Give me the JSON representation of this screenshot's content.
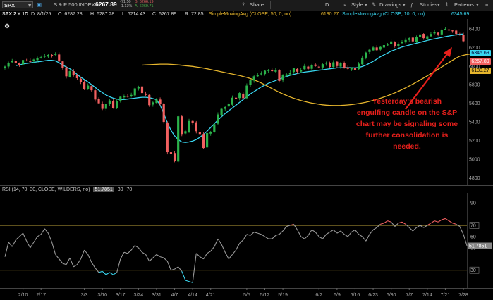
{
  "toolbar": {
    "symbol": "SPX",
    "description": "S & P 500 INDEX",
    "last_price": "6267.89",
    "change": "-71.50",
    "change_pct": "-1.13%",
    "bid": "6266.19",
    "ask": "6269.71",
    "share_label": "Share",
    "style_label": "Style",
    "drawings_label": "Drawings",
    "studies_label": "Studies",
    "patterns_label": "Patterns",
    "d_label": "D"
  },
  "infobar": {
    "symbol_period": "SPX 2 Y 1D",
    "date": "D: 8/1/25",
    "open": "O: 6287.28",
    "high": "H: 6287.28",
    "low": "L: 6214.43",
    "close": "C: 6267.89",
    "range": "R: 72.85",
    "sma50_label": "SimpleMovingAvg (CLOSE, 50, 0, no)",
    "sma50_value": "6130.27",
    "sma10_label": "SimpleMovingAvg (CLOSE, 10, 0, no)",
    "sma10_value": "6345.69"
  },
  "rsi_header": {
    "label": "RSI (14, 70, 30, CLOSE, WILDERS, no)",
    "value": "51.7851",
    "level_low": "30",
    "level_high": "70"
  },
  "annotation": "Yesterday's bearish engulfing candle on the S&P chart may be signaling some further consolidation is needed.",
  "colors": {
    "up": "#2bb34b",
    "down": "#f26060",
    "sma10": "#38d6f0",
    "sma50": "#e7b62d",
    "rsi": "#9a9a9a",
    "rsi_overbought": "#f26060",
    "rsi_oversold": "#38d6f0",
    "annotation": "#e8201c"
  },
  "price_labels": {
    "sma10": "6345.69",
    "last": "6267.89",
    "sma50": "6130.27"
  },
  "chart_data": {
    "type": "candlestick",
    "price_axis": {
      "ticks": [
        6400,
        6200,
        6000,
        5800,
        5600,
        5400,
        5200,
        5000,
        4800
      ],
      "ylim": [
        4750,
        6475
      ]
    },
    "rsi_axis": {
      "ticks": [
        90,
        70,
        60,
        50,
        30
      ],
      "ylim": [
        16,
        97
      ]
    },
    "x_ticks": [
      "2/10",
      "2/17",
      "3/3",
      "3/10",
      "3/17",
      "3/24",
      "3/31",
      "4/7",
      "4/14",
      "4/21",
      "5/5",
      "5/12",
      "5/19",
      "6/2",
      "6/9",
      "6/16",
      "6/23",
      "6/30",
      "7/7",
      "7/14",
      "7/21",
      "7/28"
    ],
    "x_tick_index": [
      5,
      10,
      22,
      27,
      32,
      37,
      42,
      47,
      52,
      57,
      67,
      72,
      77,
      87,
      92,
      97,
      102,
      107,
      112,
      117,
      122,
      127
    ],
    "closes": [
      5995,
      6035,
      6058,
      6030,
      6010,
      6065,
      6058,
      6045,
      6070,
      6088,
      6095,
      6108,
      6120,
      6115,
      6130,
      6050,
      5980,
      5890,
      5945,
      5900,
      5870,
      5830,
      5750,
      5790,
      5740,
      5640,
      5600,
      5540,
      5590,
      5630,
      5550,
      5620,
      5670,
      5680,
      5670,
      5690,
      5760,
      5775,
      5710,
      5690,
      5580,
      5610,
      5640,
      5590,
      5400,
      5075,
      5060,
      4980,
      5460,
      5270,
      5300,
      5410,
      5390,
      5300,
      5270,
      5120,
      5280,
      5290,
      5375,
      5480,
      5540,
      5560,
      5590,
      5660,
      5650,
      5710,
      5655,
      5790,
      5850,
      5890,
      5905,
      5920,
      5950,
      5955,
      5945,
      5960,
      5840,
      5900,
      5910,
      5930,
      5975,
      5940,
      5960,
      6000,
      5970,
      6010,
      6000,
      5985,
      6020,
      6035,
      5990,
      6040,
      6000,
      6030,
      5980,
      5970,
      5980,
      5960,
      6025,
      6090,
      6145,
      6175,
      6200,
      6170,
      6205,
      6225,
      6230,
      6265,
      6215,
      6240,
      6260,
      6280,
      6300,
      6265,
      6310,
      6340,
      6300,
      6320,
      6345,
      6365,
      6340,
      6390,
      6400,
      6382,
      6375,
      6345,
      6335,
      6267
    ],
    "sma10": [
      6005,
      6012,
      6022,
      6028,
      6034,
      6040,
      6045,
      6050,
      6056,
      6062,
      6062,
      6055,
      6035,
      6010,
      5990,
      5970,
      5945,
      5910,
      5880,
      5855,
      5830,
      5800,
      5770,
      5740,
      5715,
      5690,
      5670,
      5655,
      5645,
      5640,
      5640,
      5645,
      5650,
      5655,
      5660,
      5665,
      5665,
      5660,
      5650,
      5640,
      5580,
      5490,
      5390,
      5310,
      5250,
      5210,
      5185,
      5180,
      5185,
      5195,
      5210,
      5235,
      5265,
      5300,
      5340,
      5380,
      5420,
      5455,
      5490,
      5520,
      5550,
      5580,
      5610,
      5640,
      5670,
      5700,
      5725,
      5750,
      5775,
      5795,
      5815,
      5830,
      5845,
      5860,
      5875,
      5888,
      5900,
      5910,
      5920,
      5928,
      5935,
      5940,
      5945,
      5950,
      5955,
      5960,
      5965,
      5970,
      5975,
      5980,
      5982,
      5983,
      5983,
      5982,
      5980,
      5985,
      5995,
      6010,
      6030,
      6050,
      6075,
      6100,
      6120,
      6140,
      6160,
      6175,
      6190,
      6205,
      6215,
      6225,
      6235,
      6245,
      6255,
      6265,
      6275,
      6285,
      6293,
      6300,
      6308,
      6316,
      6323,
      6330,
      6336,
      6341,
      6345
    ],
    "sma50": [
      6010,
      6012,
      6014,
      6016,
      6018,
      6020,
      6020,
      6020,
      6018,
      6015,
      6012,
      6008,
      6004,
      6000,
      5996,
      5990,
      5984,
      5978,
      5970,
      5962,
      5954,
      5946,
      5938,
      5930,
      5922,
      5914,
      5906,
      5898,
      5888,
      5878,
      5866,
      5852,
      5836,
      5818,
      5798,
      5778,
      5758,
      5738,
      5718,
      5700,
      5684,
      5668,
      5654,
      5642,
      5630,
      5620,
      5610,
      5602,
      5596,
      5590,
      5584,
      5580,
      5578,
      5576,
      5576,
      5577,
      5579,
      5582,
      5586,
      5591,
      5597,
      5604,
      5612,
      5621,
      5631,
      5642,
      5654,
      5667,
      5681,
      5696,
      5712,
      5729,
      5747,
      5766,
      5786,
      5806,
      5828,
      5850,
      5872,
      5895,
      5918,
      5942,
      5966,
      5990,
      6014,
      6038,
      6062,
      6086,
      6106,
      6116,
      6124,
      6130
    ],
    "sma50_start_index": 38,
    "rsi": [
      42,
      55,
      51,
      57,
      60,
      63,
      56,
      50,
      55,
      60,
      62,
      67,
      63,
      55,
      44,
      40,
      36,
      35,
      41,
      33,
      35,
      40,
      48,
      44,
      37,
      32,
      28,
      29,
      26,
      28,
      26,
      28,
      40,
      46,
      45,
      48,
      52,
      50,
      46,
      44,
      38,
      41,
      44,
      42,
      41,
      38,
      30,
      31,
      33,
      29,
      21,
      20,
      19,
      45,
      42,
      40,
      45,
      47,
      51,
      58,
      53,
      46,
      40,
      44,
      48,
      54,
      57,
      62,
      61,
      64,
      63,
      62,
      60,
      58,
      58,
      61,
      62,
      65,
      69,
      70,
      71,
      66,
      60,
      58,
      61,
      66,
      64,
      60,
      58,
      62,
      64,
      66,
      63,
      65,
      62,
      60,
      64,
      66,
      62,
      60,
      56,
      62,
      66,
      68,
      71,
      72,
      74,
      73,
      69,
      72,
      73,
      71,
      68,
      65,
      68,
      70,
      68,
      70,
      72,
      74,
      73,
      75,
      76,
      74,
      72,
      71,
      69,
      62,
      51.79
    ]
  }
}
